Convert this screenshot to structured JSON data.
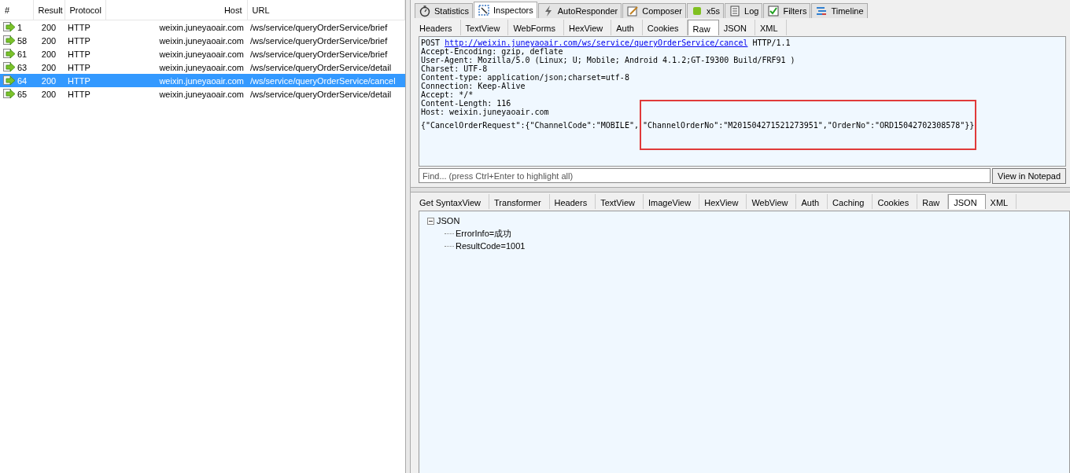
{
  "sessions": {
    "columns": [
      "#",
      "Result",
      "Protocol",
      "Host",
      "URL"
    ],
    "rows": [
      {
        "number": "1",
        "result": "200",
        "protocol": "HTTP",
        "host": "weixin.juneyaoair.com",
        "url": "/ws/service/queryOrderService/brief",
        "selected": false
      },
      {
        "number": "58",
        "result": "200",
        "protocol": "HTTP",
        "host": "weixin.juneyaoair.com",
        "url": "/ws/service/queryOrderService/brief",
        "selected": false
      },
      {
        "number": "61",
        "result": "200",
        "protocol": "HTTP",
        "host": "weixin.juneyaoair.com",
        "url": "/ws/service/queryOrderService/brief",
        "selected": false
      },
      {
        "number": "63",
        "result": "200",
        "protocol": "HTTP",
        "host": "weixin.juneyaoair.com",
        "url": "/ws/service/queryOrderService/detail",
        "selected": false
      },
      {
        "number": "64",
        "result": "200",
        "protocol": "HTTP",
        "host": "weixin.juneyaoair.com",
        "url": "/ws/service/queryOrderService/cancel",
        "selected": true
      },
      {
        "number": "65",
        "result": "200",
        "protocol": "HTTP",
        "host": "weixin.juneyaoair.com",
        "url": "/ws/service/queryOrderService/detail",
        "selected": false
      }
    ]
  },
  "main_tabs": [
    {
      "label": "Statistics",
      "kind": "stopwatch",
      "selected": false
    },
    {
      "label": "Inspectors",
      "kind": "inspect",
      "selected": true
    },
    {
      "label": "AutoResponder",
      "kind": "bolt",
      "selected": false
    },
    {
      "label": "Composer",
      "kind": "compose",
      "selected": false
    },
    {
      "label": "x5s",
      "kind": "square",
      "selected": false
    },
    {
      "label": "Log",
      "kind": "log",
      "selected": false
    },
    {
      "label": "Filters",
      "kind": "check",
      "selected": false
    },
    {
      "label": "Timeline",
      "kind": "timeline",
      "selected": false
    }
  ],
  "request_tabs": [
    {
      "label": "Headers",
      "selected": false
    },
    {
      "label": "TextView",
      "selected": false
    },
    {
      "label": "WebForms",
      "selected": false
    },
    {
      "label": "HexView",
      "selected": false
    },
    {
      "label": "Auth",
      "selected": false
    },
    {
      "label": "Cookies",
      "selected": false
    },
    {
      "label": "Raw",
      "selected": true
    },
    {
      "label": "JSON",
      "selected": false
    },
    {
      "label": "XML",
      "selected": false
    }
  ],
  "raw_request": {
    "method": "POST",
    "url": "http://weixin.juneyaoair.com/ws/service/queryOrderService/cancel",
    "version": "HTTP/1.1",
    "headers": [
      "Accept-Encoding: gzip, deflate",
      "User-Agent: Mozilla/5.0 (Linux; U; Mobile; Android 4.1.2;GT-I9300 Build/FRF91 )",
      "Charset: UTF-8",
      "Content-type: application/json;charset=utf-8",
      "Connection: Keep-Alive",
      "Accept: */*",
      "Content-Length: 116",
      "Host: weixin.juneyaoair.com"
    ],
    "body": [
      {
        "text": "{\"CancelOrderRequest\":{\"ChannelCode\":\"MOBILE\",",
        "highlighted": false
      },
      {
        "text": "\"ChannelOrderNo\":\"M201504271521273951\",\"OrderNo\":\"ORD15042702308578\"}}",
        "highlighted": true
      }
    ]
  },
  "find_bar": {
    "placeholder": "Find... (press Ctrl+Enter to highlight all)",
    "button": "View in Notepad"
  },
  "response_tabs": [
    {
      "label": "Get SyntaxView",
      "selected": false
    },
    {
      "label": "Transformer",
      "selected": false
    },
    {
      "label": "Headers",
      "selected": false
    },
    {
      "label": "TextView",
      "selected": false
    },
    {
      "label": "ImageView",
      "selected": false
    },
    {
      "label": "HexView",
      "selected": false
    },
    {
      "label": "WebView",
      "selected": false
    },
    {
      "label": "Auth",
      "selected": false
    },
    {
      "label": "Caching",
      "selected": false
    },
    {
      "label": "Cookies",
      "selected": false
    },
    {
      "label": "Raw",
      "selected": false
    },
    {
      "label": "JSON",
      "selected": true
    },
    {
      "label": "XML",
      "selected": false
    }
  ],
  "response_tree": {
    "label": "JSON",
    "expanded": true,
    "children": [
      {
        "label": "ErrorInfo=成功"
      },
      {
        "label": "ResultCode=1001"
      }
    ]
  }
}
